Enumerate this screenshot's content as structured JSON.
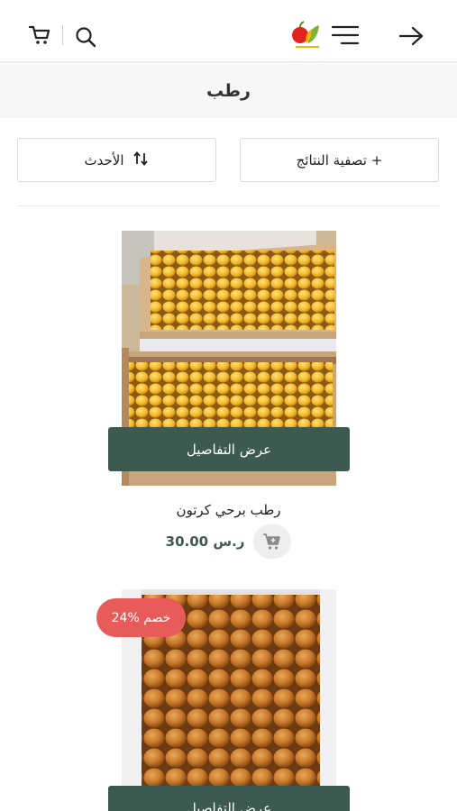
{
  "header": {
    "back_icon": "arrow-right-icon",
    "menu_icon": "menu-icon",
    "logo_icon": "store-logo",
    "search_icon": "search-icon",
    "cart_icon": "cart-icon"
  },
  "page": {
    "title": "رطب"
  },
  "controls": {
    "filter_label": "تصفية النتائج +",
    "sort_label": "الأحدث"
  },
  "products": [
    {
      "name": "رطب برحي كرتون",
      "price": "30.00 ر.س",
      "details_label": "عرض التفاصيل"
    },
    {
      "badge": "24% خصم",
      "details_label": "عرض التفاصيل"
    }
  ],
  "colors": {
    "accent": "#3c5a50",
    "badge": "#e85b5b",
    "title_band": "#f6f6f6"
  }
}
